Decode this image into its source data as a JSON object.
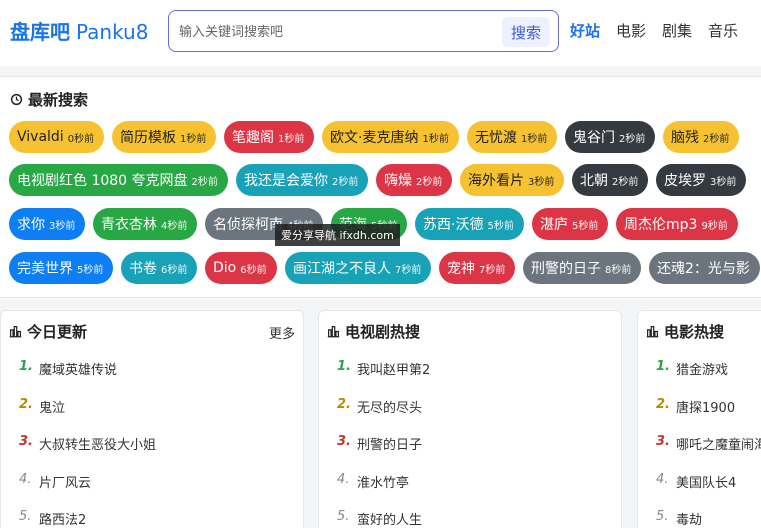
{
  "header": {
    "logo_cn": "盘库吧",
    "logo_en": "Panku8",
    "search_placeholder": "输入关键词搜索吧",
    "search_button": "搜索",
    "nav": [
      "好站",
      "电影",
      "剧集",
      "音乐"
    ]
  },
  "recent": {
    "title": "最新搜索",
    "tags": [
      {
        "label": "Vivaldi",
        "time": "0秒前",
        "color": "yellow"
      },
      {
        "label": "简历模板",
        "time": "1秒前",
        "color": "yellow"
      },
      {
        "label": "笔趣阁",
        "time": "1秒前",
        "color": "red"
      },
      {
        "label": "欧文·麦克唐纳",
        "time": "1秒前",
        "color": "yellow"
      },
      {
        "label": "无忧渡",
        "time": "1秒前",
        "color": "yellow"
      },
      {
        "label": "鬼谷门",
        "time": "2秒前",
        "color": "dark"
      },
      {
        "label": "脑残",
        "time": "2秒前",
        "color": "yellow"
      },
      {
        "label": "电视剧红色 1080 夸克网盘",
        "time": "2秒前",
        "color": "green"
      },
      {
        "label": "我还是会爱你",
        "time": "2秒前",
        "color": "teal"
      },
      {
        "label": "嗨燥",
        "time": "2秒前",
        "color": "red"
      },
      {
        "label": "海外看片",
        "time": "3秒前",
        "color": "yellow"
      },
      {
        "label": "北朝",
        "time": "2秒前",
        "color": "dark"
      },
      {
        "label": "皮埃罗",
        "time": "3秒前",
        "color": "dark"
      },
      {
        "label": "求你",
        "time": "3秒前",
        "color": "blue"
      },
      {
        "label": "青衣杏林",
        "time": "4秒前",
        "color": "green"
      },
      {
        "label": "名侦探柯南",
        "time": "4秒前",
        "color": "gray"
      },
      {
        "label": "范海",
        "time": "5秒前",
        "color": "green"
      },
      {
        "label": "苏西·沃德",
        "time": "5秒前",
        "color": "teal"
      },
      {
        "label": "湛庐",
        "time": "5秒前",
        "color": "red"
      },
      {
        "label": "周杰伦mp3",
        "time": "9秒前",
        "color": "red"
      },
      {
        "label": "完美世界",
        "time": "5秒前",
        "color": "blue"
      },
      {
        "label": "书卷",
        "time": "6秒前",
        "color": "teal"
      },
      {
        "label": "Dio",
        "time": "6秒前",
        "color": "red"
      },
      {
        "label": "画江湖之不良人",
        "time": "7秒前",
        "color": "teal"
      },
      {
        "label": "宠神",
        "time": "7秒前",
        "color": "red"
      },
      {
        "label": "刑警的日子",
        "time": "8秒前",
        "color": "gray"
      },
      {
        "label": "还魂2：光与影",
        "time": "",
        "color": "gray"
      }
    ]
  },
  "watermark": "爱分享导航 ifxdh.com",
  "panels": [
    {
      "title": "今日更新",
      "more": "更多",
      "items": [
        "魔域英雄传说",
        "鬼泣",
        "大叔转生恶役大小姐",
        "片厂风云",
        "路西法2"
      ]
    },
    {
      "title": "电视剧热搜",
      "more": "",
      "items": [
        "我叫赵甲第2",
        "无尽的尽头",
        "刑警的日子",
        "淮水竹亭",
        "蛮好的人生"
      ]
    },
    {
      "title": "电影热搜",
      "more": "",
      "items": [
        "猎金游戏",
        "唐探1900",
        "哪吒之魔童闹海",
        "美国队长4",
        "毒劫"
      ]
    }
  ]
}
